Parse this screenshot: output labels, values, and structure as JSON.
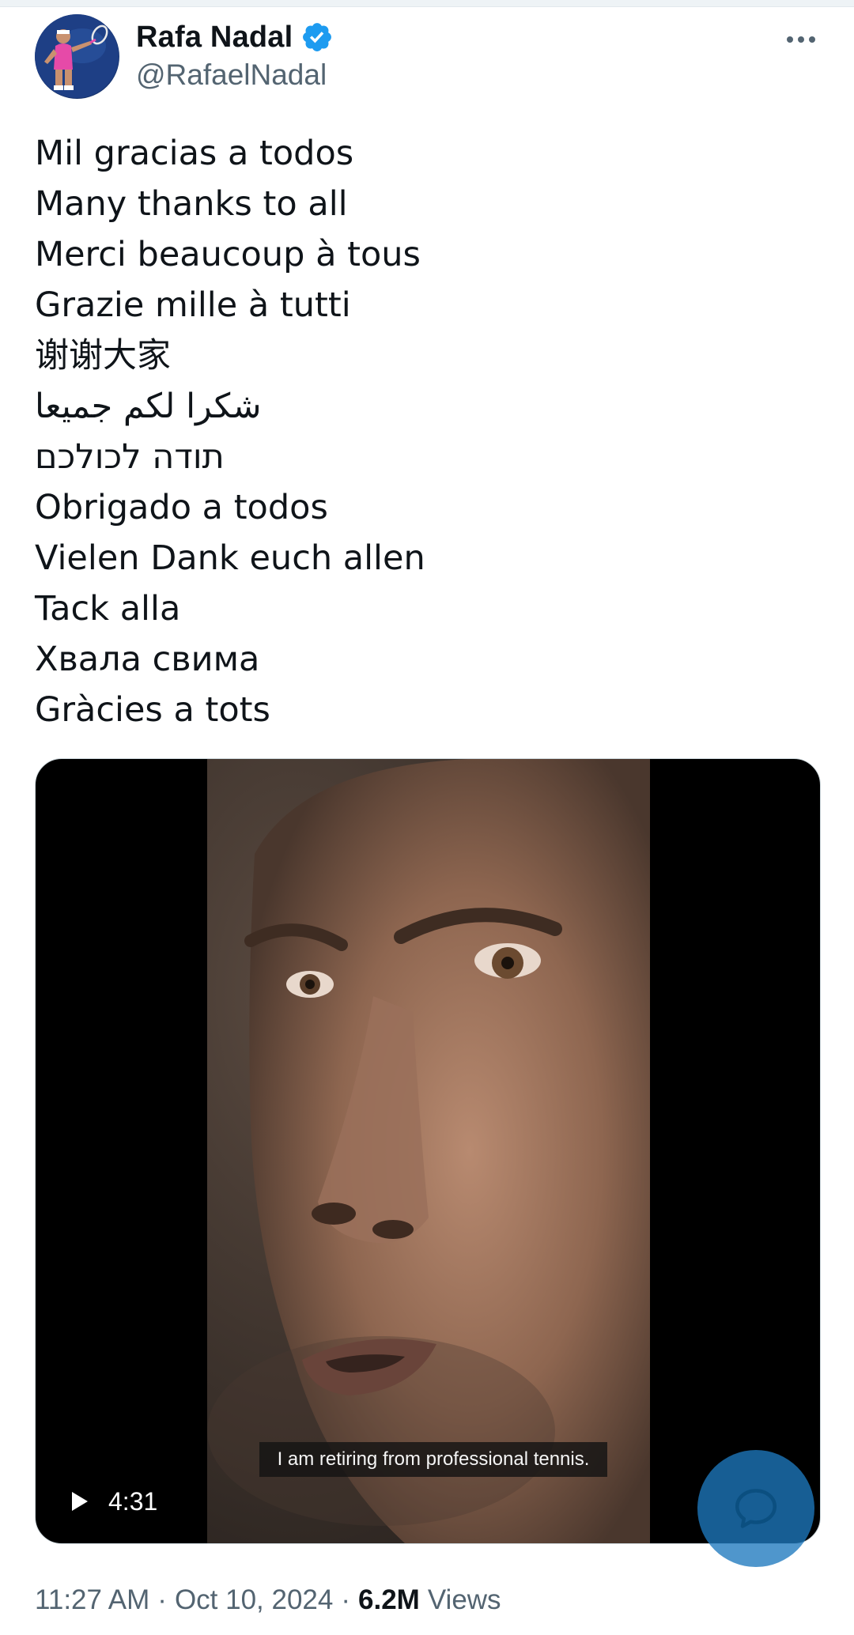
{
  "author": {
    "display_name": "Rafa Nadal",
    "handle": "@RafaelNadal",
    "verified": true,
    "verified_color": "#1d9bf0"
  },
  "menu": {
    "icon": "more-horizontal-icon"
  },
  "tweet": {
    "lines": [
      "Mil gracias a todos",
      "Many thanks to all",
      "Merci beaucoup à tous",
      "Grazie mille à tutti",
      "谢谢大家",
      "شكرا لكم جميعا",
      "תודה לכולכם",
      "Obrigado a todos",
      "Vielen Dank euch allen",
      "Tack alla",
      "Хвала свима",
      "Gràcies a tots"
    ]
  },
  "video": {
    "caption": "I am retiring from professional tennis.",
    "duration": "4:31",
    "play_icon": "play-icon"
  },
  "fab": {
    "icon": "chat-bubble-icon",
    "color": "#1d78be"
  },
  "meta": {
    "time": "11:27 AM",
    "separator": "·",
    "date": "Oct 10, 2024",
    "views_count": "6.2M",
    "views_label": "Views"
  }
}
